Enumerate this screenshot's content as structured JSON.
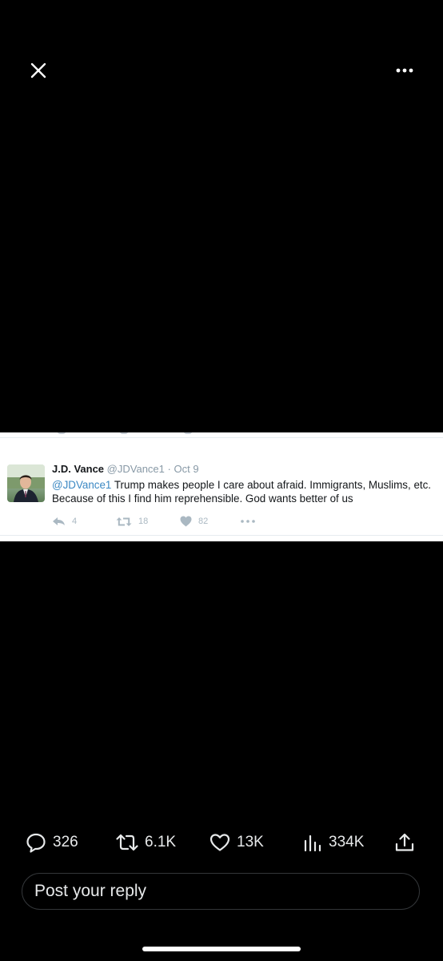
{
  "toolbar": {
    "close_icon": "close-icon",
    "more_icon": "more-horizontal-icon"
  },
  "tweet": {
    "author_name": "J.D. Vance",
    "handle": "@JDVance1",
    "separator": "·",
    "date": "Oct 9",
    "mention": "@JDVance1",
    "line1_rest": " Trump makes people I care about afraid. Immigrants, Muslims, etc.",
    "line2": "Because of this I find him reprehensible. God wants better of us",
    "replies": "4",
    "retweets": "18",
    "likes": "82"
  },
  "engagement": {
    "replies": "326",
    "reposts": "6.1K",
    "likes": "13K",
    "views": "334K"
  },
  "reply_box": {
    "placeholder": "Post your reply"
  },
  "colors": {
    "background": "#000000",
    "text_primary": "#e7e9ea",
    "tweet_link": "#3b88c3",
    "tweet_meta": "#8899a6"
  }
}
